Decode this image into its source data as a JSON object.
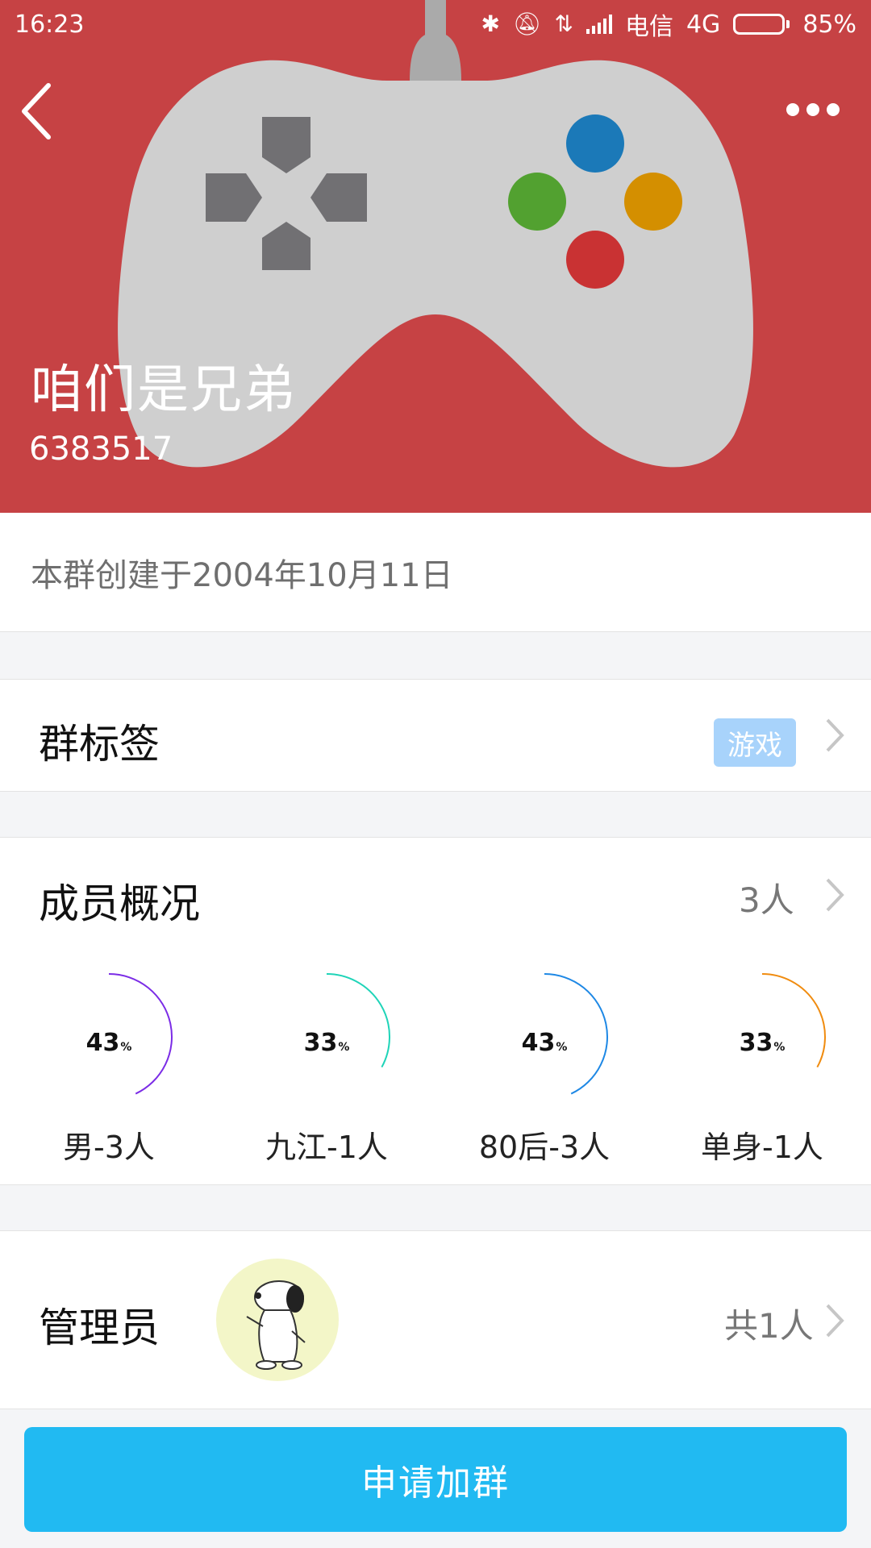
{
  "status_bar": {
    "time": "16:23",
    "carrier": "电信",
    "network": "4G",
    "battery": "85%",
    "battery_level": 0.85,
    "icons": [
      "bluetooth-icon",
      "silent-icon",
      "data-transfer-icon",
      "signal-icon"
    ]
  },
  "header": {
    "back_icon": "chevron-left-icon",
    "more_icon": "more-dots-icon",
    "group_name": "咱们是兄弟",
    "group_id": "6383517",
    "cover_icon": "gamepad-icon",
    "cover_color": "#c64244"
  },
  "created_text": "本群创建于2004年10月11日",
  "tags_row": {
    "title": "群标签",
    "tag": "游戏",
    "tag_color": "#a8d3fb"
  },
  "members_row": {
    "title": "成员概况",
    "count": "3人"
  },
  "member_stats": [
    {
      "percent": "43",
      "percent_value": 43,
      "unit": "%",
      "label": "男-3人",
      "color": "#7b2ce6"
    },
    {
      "percent": "33",
      "percent_value": 33,
      "unit": "%",
      "label": "九江-1人",
      "color": "#1fd4b8"
    },
    {
      "percent": "43",
      "percent_value": 43,
      "unit": "%",
      "label": "80后-3人",
      "color": "#1e88e5"
    },
    {
      "percent": "33",
      "percent_value": 33,
      "unit": "%",
      "label": "单身-1人",
      "color": "#f08c10"
    }
  ],
  "admin_row": {
    "title": "管理员",
    "count": "共1人",
    "avatar_icon": "snoopy-avatar-icon"
  },
  "join_button": "申请加群",
  "accent_color": "#21baf2"
}
